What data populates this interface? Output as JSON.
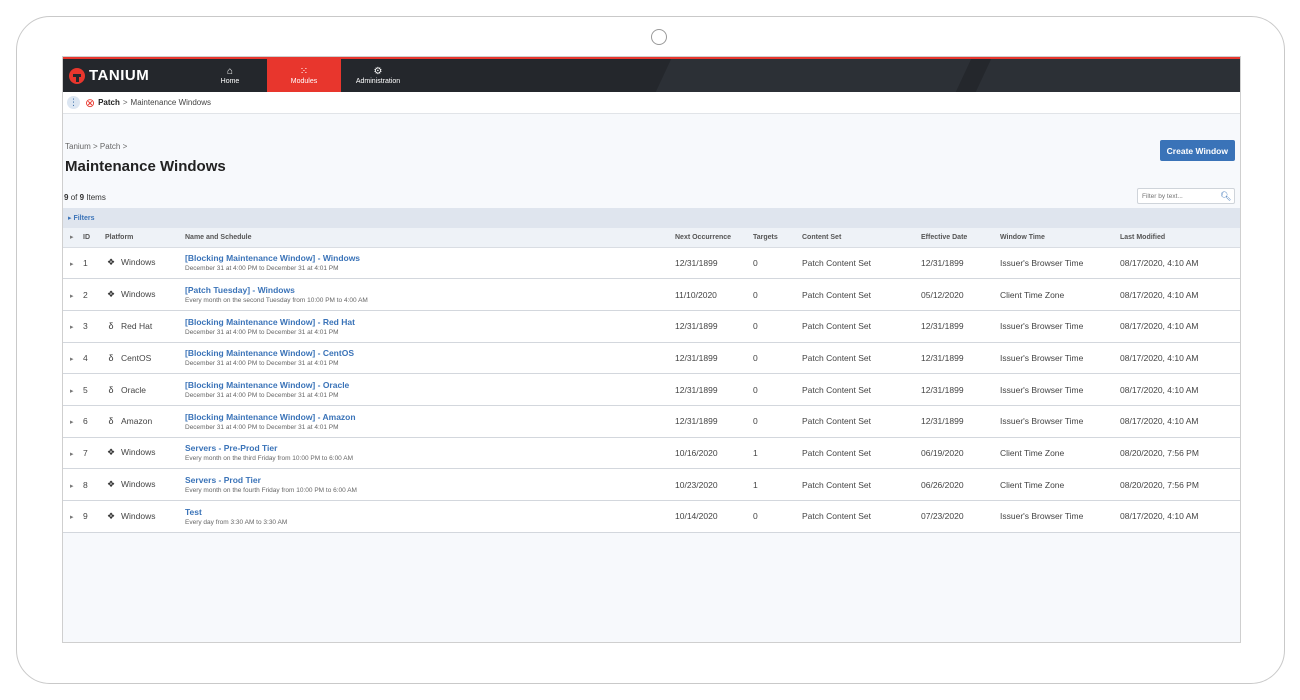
{
  "nav": {
    "logo": "TANIUM",
    "items": [
      {
        "label": "Home",
        "icon": "home-icon",
        "glyph": "⌂"
      },
      {
        "label": "Modules",
        "icon": "grid-icon",
        "glyph": "⁙"
      },
      {
        "label": "Administration",
        "icon": "gears-icon",
        "glyph": "⚙"
      }
    ]
  },
  "breadcrumb_bar": {
    "menu_glyph": "⋮",
    "module": "Patch",
    "separator": ">",
    "current": "Maintenance Windows"
  },
  "page": {
    "breadcrumb": "Tanium > Patch >",
    "title": "Maintenance Windows",
    "create_button": "Create Window",
    "count_shown": "9",
    "count_of": "of",
    "count_total": "9",
    "count_label": "Items",
    "filter_placeholder": "Filter by text...",
    "filters_label": "▸ Filters"
  },
  "table": {
    "columns": [
      "ID",
      "Platform",
      "Name and Schedule",
      "Next Occurrence",
      "Targets",
      "Content Set",
      "Effective Date",
      "Window Time",
      "Last Modified"
    ],
    "rows": [
      {
        "id": "1",
        "platform": "Windows",
        "icon": "windows-icon",
        "name": "[Blocking Maintenance Window] - Windows",
        "schedule": "December 31 at 4:00 PM to December 31 at 4:01 PM",
        "next": "12/31/1899",
        "targets": "0",
        "content_set": "Patch Content Set",
        "effective": "12/31/1899",
        "window_time": "Issuer's Browser Time",
        "modified": "08/17/2020, 4:10 AM"
      },
      {
        "id": "2",
        "platform": "Windows",
        "icon": "windows-icon",
        "name": "[Patch Tuesday] - Windows",
        "schedule": "Every month on the second Tuesday from 10:00 PM to 4:00 AM",
        "next": "11/10/2020",
        "targets": "0",
        "content_set": "Patch Content Set",
        "effective": "05/12/2020",
        "window_time": "Client Time Zone",
        "modified": "08/17/2020, 4:10 AM"
      },
      {
        "id": "3",
        "platform": "Red Hat",
        "icon": "linux-icon",
        "name": "[Blocking Maintenance Window] - Red Hat",
        "schedule": "December 31 at 4:00 PM to December 31 at 4:01 PM",
        "next": "12/31/1899",
        "targets": "0",
        "content_set": "Patch Content Set",
        "effective": "12/31/1899",
        "window_time": "Issuer's Browser Time",
        "modified": "08/17/2020, 4:10 AM"
      },
      {
        "id": "4",
        "platform": "CentOS",
        "icon": "linux-icon",
        "name": "[Blocking Maintenance Window] - CentOS",
        "schedule": "December 31 at 4:00 PM to December 31 at 4:01 PM",
        "next": "12/31/1899",
        "targets": "0",
        "content_set": "Patch Content Set",
        "effective": "12/31/1899",
        "window_time": "Issuer's Browser Time",
        "modified": "08/17/2020, 4:10 AM"
      },
      {
        "id": "5",
        "platform": "Oracle",
        "icon": "linux-icon",
        "name": "[Blocking Maintenance Window] - Oracle",
        "schedule": "December 31 at 4:00 PM to December 31 at 4:01 PM",
        "next": "12/31/1899",
        "targets": "0",
        "content_set": "Patch Content Set",
        "effective": "12/31/1899",
        "window_time": "Issuer's Browser Time",
        "modified": "08/17/2020, 4:10 AM"
      },
      {
        "id": "6",
        "platform": "Amazon",
        "icon": "linux-icon",
        "name": "[Blocking Maintenance Window] - Amazon",
        "schedule": "December 31 at 4:00 PM to December 31 at 4:01 PM",
        "next": "12/31/1899",
        "targets": "0",
        "content_set": "Patch Content Set",
        "effective": "12/31/1899",
        "window_time": "Issuer's Browser Time",
        "modified": "08/17/2020, 4:10 AM"
      },
      {
        "id": "7",
        "platform": "Windows",
        "icon": "windows-icon",
        "name": "Servers - Pre-Prod Tier",
        "schedule": "Every month on the third Friday from 10:00 PM to 6:00 AM",
        "next": "10/16/2020",
        "targets": "1",
        "content_set": "Patch Content Set",
        "effective": "06/19/2020",
        "window_time": "Client Time Zone",
        "modified": "08/20/2020, 7:56 PM"
      },
      {
        "id": "8",
        "platform": "Windows",
        "icon": "windows-icon",
        "name": "Servers - Prod Tier",
        "schedule": "Every month on the fourth Friday from 10:00 PM to 6:00 AM",
        "next": "10/23/2020",
        "targets": "1",
        "content_set": "Patch Content Set",
        "effective": "06/26/2020",
        "window_time": "Client Time Zone",
        "modified": "08/20/2020, 7:56 PM"
      },
      {
        "id": "9",
        "platform": "Windows",
        "icon": "windows-icon",
        "name": "Test",
        "schedule": "Every day from 3:30 AM to 3:30 AM",
        "next": "10/14/2020",
        "targets": "0",
        "content_set": "Patch Content Set",
        "effective": "07/23/2020",
        "window_time": "Issuer's Browser Time",
        "modified": "08/17/2020, 4:10 AM"
      }
    ]
  },
  "colors": {
    "accent": "#e8362d",
    "nav_bg": "#24272c",
    "link": "#3a73b8"
  }
}
